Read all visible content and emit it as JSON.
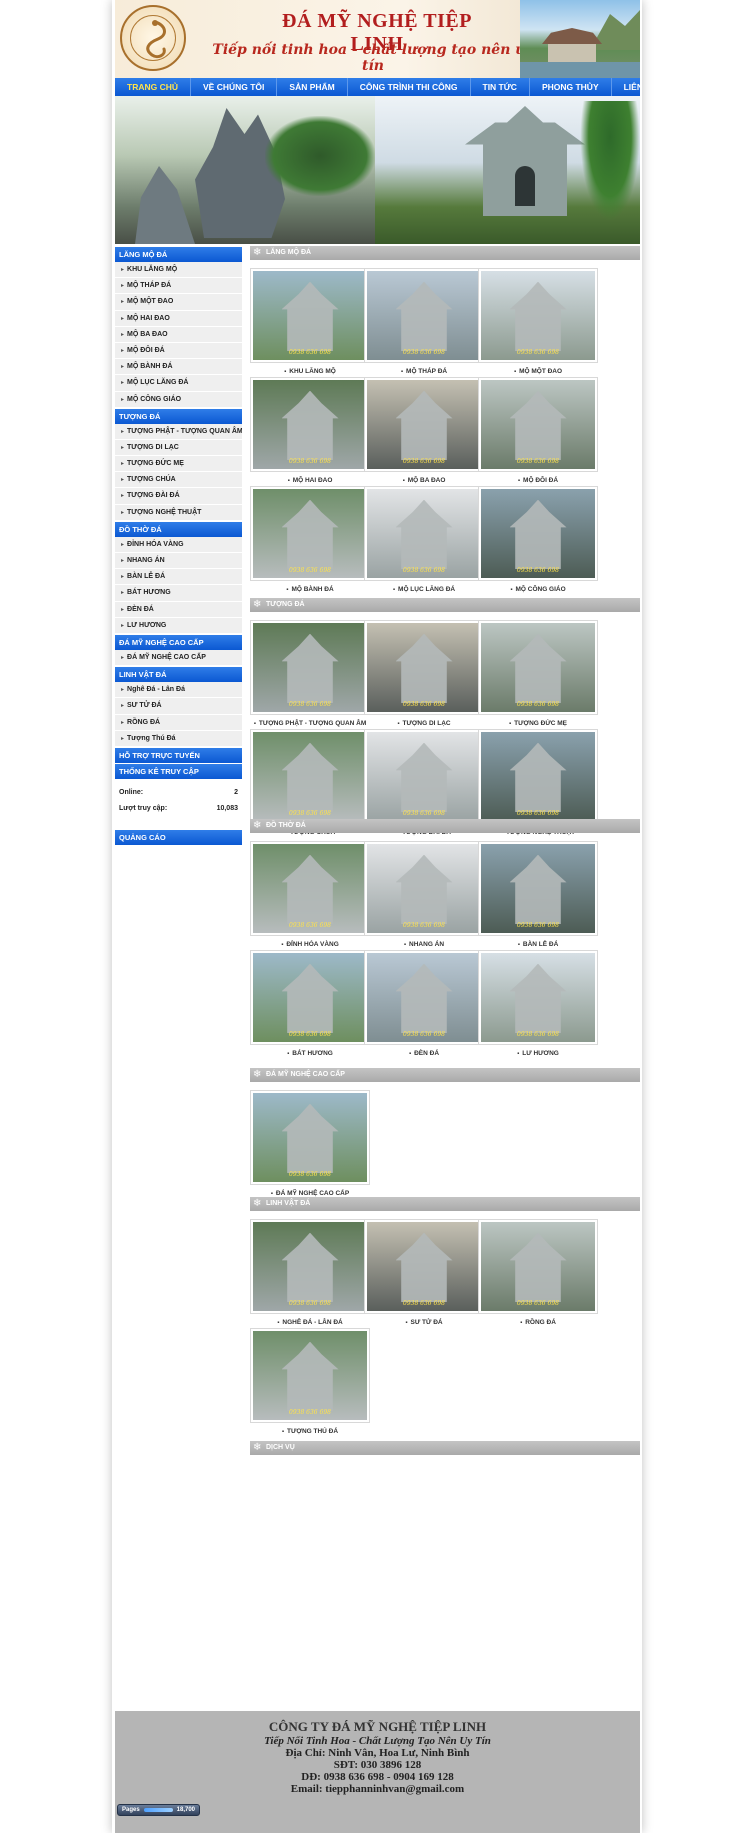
{
  "header": {
    "title": "ĐÁ MỸ NGHỆ TIỆP LINH",
    "slogan": "Tiếp nối tinh hoa - chất lượng tạo nên uy tín"
  },
  "nav": {
    "items": [
      "TRANG CHỦ",
      "VỀ CHÚNG TÔI",
      "SẢN PHẨM",
      "CÔNG TRÌNH THI CÔNG",
      "TIN TỨC",
      "PHONG THỦY",
      "LIÊN HỆ"
    ]
  },
  "sidebar": {
    "sections": [
      {
        "title": "LĂNG MỘ ĐÁ",
        "items": [
          "KHU LĂNG MỘ",
          "MỘ THÁP ĐÁ",
          "MỘ MỘT ĐAO",
          "MỘ HAI ĐAO",
          "MỘ BA ĐAO",
          "MỘ ĐÔI ĐÁ",
          "MỘ BÀNH ĐÁ",
          "MỘ LỤC LĂNG ĐÁ",
          "MỘ CÔNG GIÁO"
        ]
      },
      {
        "title": "TƯỢNG ĐÁ",
        "items": [
          "TƯỢNG PHẬT - TƯỢNG QUAN ÂM",
          "TƯỢNG DI LẠC",
          "TƯỢNG ĐỨC MẸ",
          "TƯỢNG CHÚA",
          "TƯỢNG ĐÀI ĐÁ",
          "TƯỢNG NGHỆ THUẬT"
        ]
      },
      {
        "title": "ĐỒ THỜ ĐÁ",
        "items": [
          "ĐỈNH HÓA VÀNG",
          "NHANG ÁN",
          "BÀN LỄ ĐÁ",
          "BÁT HƯƠNG",
          "ĐÈN ĐÁ",
          "LƯ HƯƠNG"
        ]
      },
      {
        "title": "ĐÁ MỸ NGHỆ CAO CẤP",
        "items": [
          "ĐÁ MỸ NGHỆ CAO CẤP"
        ]
      },
      {
        "title": "LINH VẬT ĐÁ",
        "items": [
          "Nghê Đá - Lân Đá",
          "SƯ TỬ ĐÁ",
          "RỒNG ĐÁ",
          "Tượng Thú Đá"
        ]
      }
    ],
    "support_title": "HỖ TRỢ TRỰC TUYẾN",
    "stats_title": "THỐNG KÊ TRUY CẬP",
    "online_label": "Online:",
    "online_value": "2",
    "visits_label": "Lượt truy cập:",
    "visits_value": "10,083",
    "ads_title": "QUẢNG CÁO"
  },
  "main": {
    "sections": [
      {
        "title": "LĂNG MỘ ĐÁ",
        "items": [
          "KHU LĂNG MỘ",
          "MỘ THÁP ĐÁ",
          "MỘ MỘT ĐAO",
          "MỘ HAI ĐAO",
          "MỘ BA ĐAO",
          "MỘ ĐÔI ĐÁ",
          "MỘ BÀNH ĐÁ",
          "MỘ LỤC LĂNG ĐÁ",
          "MỘ CÔNG GIÁO"
        ]
      },
      {
        "title": "TƯỢNG ĐÁ",
        "items": [
          "TƯỢNG PHẬT - TƯỢNG QUAN ÂM",
          "TƯỢNG DI LẠC",
          "TƯỢNG ĐỨC MẸ",
          "TƯỢNG CHÚA",
          "TƯỢNG ĐÀI ĐÁ",
          "TƯỢNG NGHỆ THUẬT"
        ]
      },
      {
        "title": "ĐỒ THỜ ĐÁ",
        "items": [
          "ĐỈNH HÓA VÀNG",
          "NHANG ÁN",
          "BÀN LỄ ĐÁ",
          "BÁT HƯƠNG",
          "ĐÈN ĐÁ",
          "LƯ HƯƠNG"
        ]
      },
      {
        "title": "ĐÁ MỸ NGHỆ CAO CẤP",
        "items": [
          "ĐÁ MỸ NGHỆ CAO CẤP"
        ]
      },
      {
        "title": "LINH VẬT ĐÁ",
        "items": [
          "NGHÊ ĐÁ - LÂN ĐÁ",
          "SƯ TỬ ĐÁ",
          "RỒNG ĐÁ",
          "TƯỢNG THÚ ĐÁ"
        ]
      },
      {
        "title": "DỊCH VỤ",
        "items": []
      }
    ],
    "watermark_phone": "0938 636 698",
    "watermark_site": "damynghetieplinh.com"
  },
  "footer": {
    "company": "CÔNG TY ĐÁ MỸ NGHỆ TIỆP LINH",
    "slogan": "Tiếp Nối Tinh Hoa - Chất Lượng Tạo Nên Uy Tín",
    "address": "Địa Chỉ: Ninh Vân, Hoa Lư, Ninh Bình",
    "phone": "SĐT: 030 3896 128",
    "mobile": "DĐ: 0938 636 698 - 0904 169 128",
    "email": "Email: tiepphanninhvan@gmail.com"
  },
  "counter": {
    "label": "Pages",
    "value": "18,700"
  },
  "colors": {
    "nav_blue": "#0b58d2",
    "section_gray": "#a9a9a9",
    "title_red": "#b21e1e",
    "footer_gray": "#b5b5b5"
  }
}
